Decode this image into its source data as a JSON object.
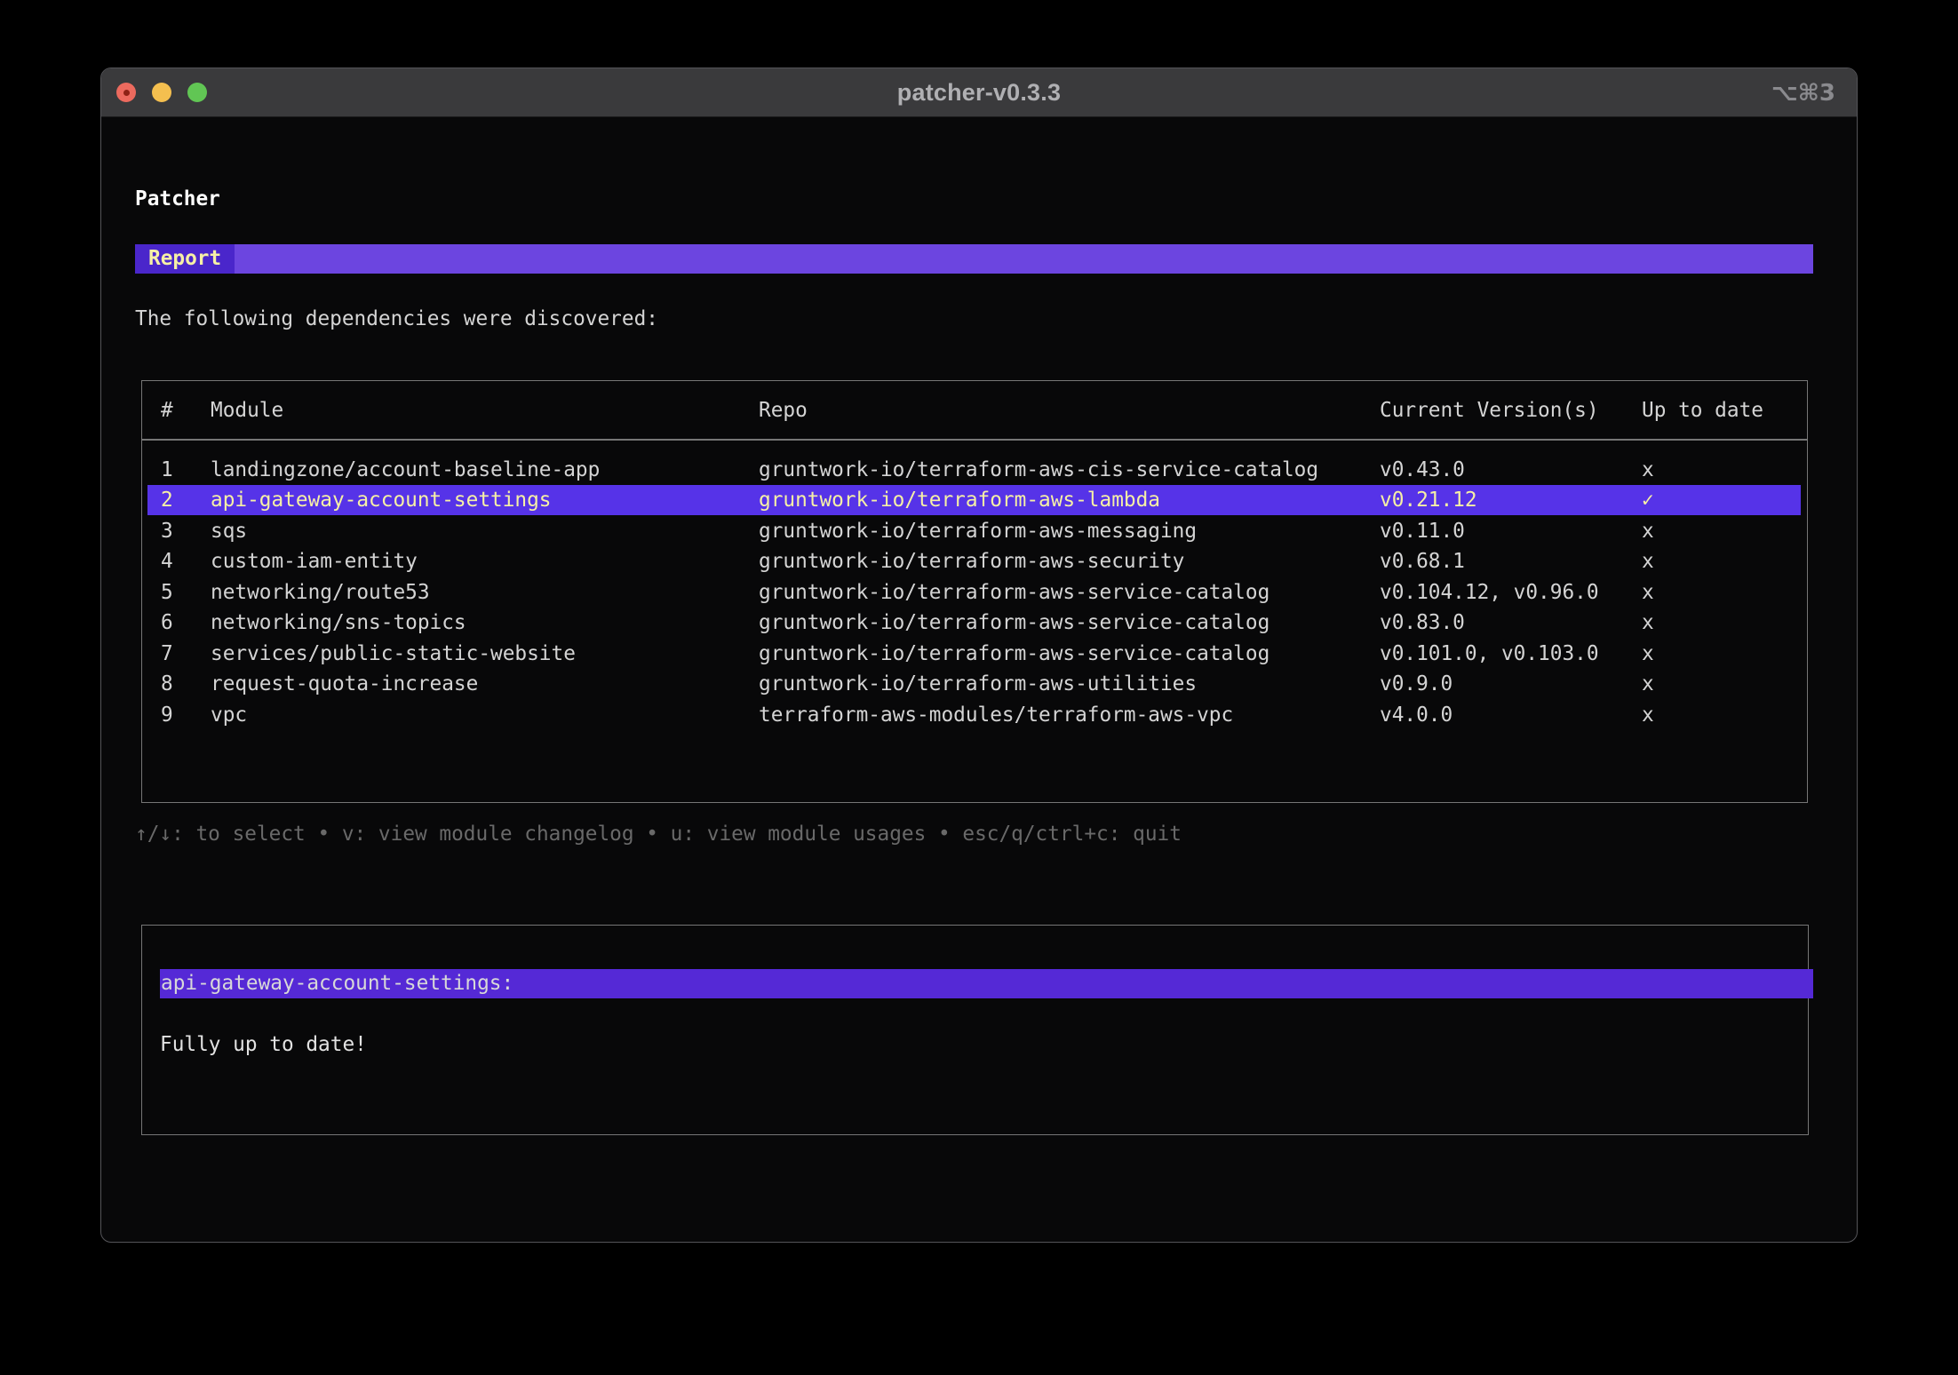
{
  "window": {
    "title": "patcher-v0.3.3",
    "shortcut": "⌥⌘3"
  },
  "app": {
    "title": "Patcher",
    "section_label": "Report",
    "intro": "The following dependencies were discovered:"
  },
  "table": {
    "columns": [
      "#",
      "Module",
      "Repo",
      "Current Version(s)",
      "Up to date"
    ],
    "rows": [
      {
        "num": "1",
        "module": "landingzone/account-baseline-app",
        "repo": "gruntwork-io/terraform-aws-cis-service-catalog",
        "version": "v0.43.0",
        "up_to_date": "x",
        "selected": false
      },
      {
        "num": "2",
        "module": "api-gateway-account-settings",
        "repo": "gruntwork-io/terraform-aws-lambda",
        "version": "v0.21.12",
        "up_to_date": "✓",
        "selected": true
      },
      {
        "num": "3",
        "module": "sqs",
        "repo": "gruntwork-io/terraform-aws-messaging",
        "version": "v0.11.0",
        "up_to_date": "x",
        "selected": false
      },
      {
        "num": "4",
        "module": "custom-iam-entity",
        "repo": "gruntwork-io/terraform-aws-security",
        "version": "v0.68.1",
        "up_to_date": "x",
        "selected": false
      },
      {
        "num": "5",
        "module": "networking/route53",
        "repo": "gruntwork-io/terraform-aws-service-catalog",
        "version": "v0.104.12, v0.96.0",
        "up_to_date": "x",
        "selected": false
      },
      {
        "num": "6",
        "module": "networking/sns-topics",
        "repo": "gruntwork-io/terraform-aws-service-catalog",
        "version": "v0.83.0",
        "up_to_date": "x",
        "selected": false
      },
      {
        "num": "7",
        "module": "services/public-static-website",
        "repo": "gruntwork-io/terraform-aws-service-catalog",
        "version": "v0.101.0, v0.103.0",
        "up_to_date": "x",
        "selected": false
      },
      {
        "num": "8",
        "module": "request-quota-increase",
        "repo": "gruntwork-io/terraform-aws-utilities",
        "version": "v0.9.0",
        "up_to_date": "x",
        "selected": false
      },
      {
        "num": "9",
        "module": "vpc",
        "repo": "terraform-aws-modules/terraform-aws-vpc",
        "version": "v4.0.0",
        "up_to_date": "x",
        "selected": false
      }
    ]
  },
  "help": "↑/↓: to select • v: view module changelog • u: view module usages • esc/q/ctrl+c: quit",
  "detail": {
    "title": "api-gateway-account-settings:",
    "body": "Fully up to date!"
  },
  "colors": {
    "titlebar_bg": "#3a3a3c",
    "purple_light": "#6c45e0",
    "purple_dark": "#4a26cb",
    "purple_row": "#5633e8",
    "purple_row2": "#5529d6",
    "cream": "#f6f0a6",
    "tl_red": "#ec6a5e",
    "tl_yellow": "#f4bf4f",
    "tl_green": "#61c654"
  }
}
